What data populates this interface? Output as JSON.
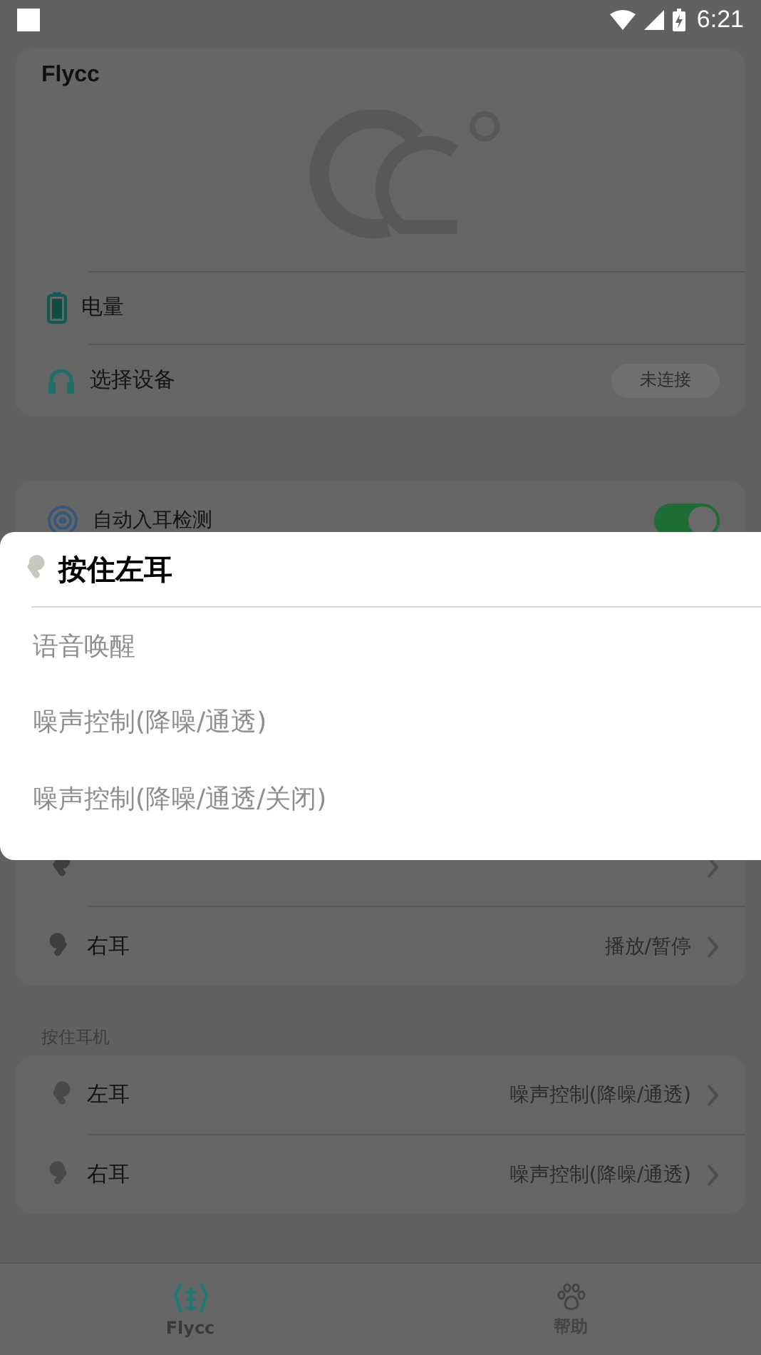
{
  "status_bar": {
    "time": "6:21"
  },
  "device_card": {
    "title": "Flycc",
    "battery_label": "电量",
    "device_label": "选择设备",
    "connection_button": "未连接"
  },
  "auto_ear_detection": {
    "label": "自动入耳检测",
    "on": true
  },
  "tap_card": {
    "rows": [
      {
        "kind": "left"
      },
      {
        "kind": "right",
        "label": "右耳",
        "value": "播放/暂停"
      }
    ]
  },
  "hold_section": {
    "title": "按住耳机",
    "rows": [
      {
        "kind": "left",
        "label": "左耳",
        "value": "噪声控制(降噪/通透)"
      },
      {
        "kind": "right",
        "label": "右耳",
        "value": "噪声控制(降噪/通透)"
      }
    ]
  },
  "bottom_nav": [
    {
      "label": "Flycc",
      "kind": "home",
      "selected": true
    },
    {
      "label": "帮助",
      "kind": "help",
      "selected": false
    }
  ],
  "dialog": {
    "title": "按住左耳",
    "kind": "left",
    "options": [
      "语音唤醒",
      "噪声控制(降噪/通透)",
      "噪声控制(降噪/通透/关闭)"
    ]
  }
}
